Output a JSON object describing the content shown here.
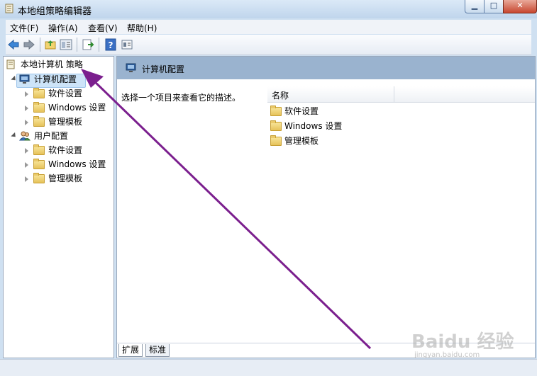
{
  "window": {
    "title": "本地组策略编辑器"
  },
  "menu": [
    "文件(F)",
    "操作(A)",
    "查看(V)",
    "帮助(H)"
  ],
  "tree": {
    "root": "本地计算机 策略",
    "computer": {
      "label": "计算机配置",
      "children": [
        "软件设置",
        "Windows 设置",
        "管理模板"
      ]
    },
    "user": {
      "label": "用户配置",
      "children": [
        "软件设置",
        "Windows 设置",
        "管理模板"
      ]
    }
  },
  "content": {
    "header": "计算机配置",
    "description": "选择一个项目来查看它的描述。",
    "column_name": "名称",
    "items": [
      "软件设置",
      "Windows 设置",
      "管理模板"
    ]
  },
  "tabs": [
    "扩展",
    "标准"
  ],
  "watermark": {
    "text": "Baidu 经验",
    "sub": "jingyan.baidu.com"
  },
  "colors": {
    "annotation_arrow": "#7b1f8e",
    "header_band": "#9ab3cf",
    "selection": "#cde4f8"
  }
}
